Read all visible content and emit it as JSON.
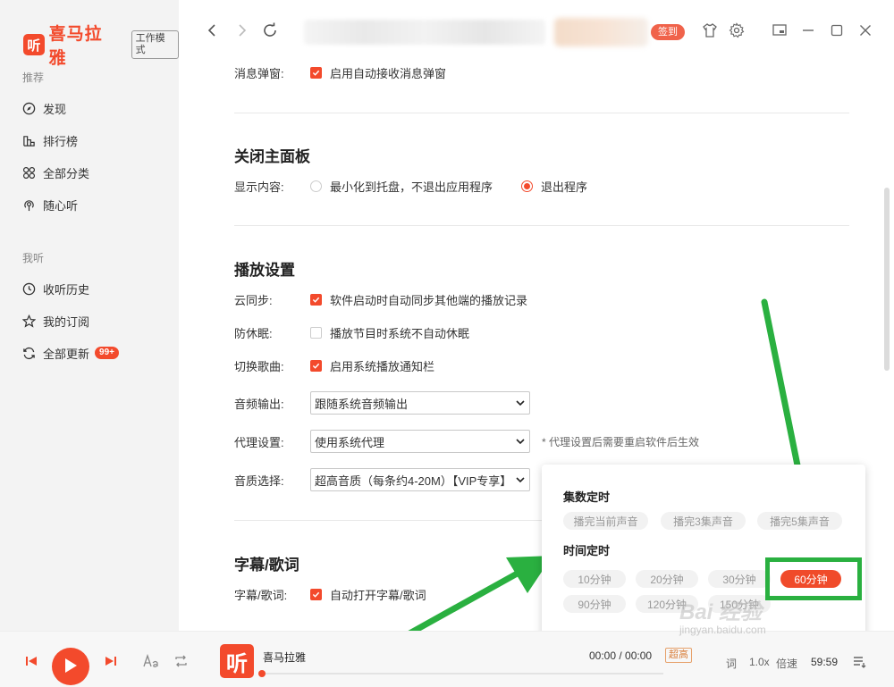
{
  "app": {
    "logo_glyph": "听",
    "name": "喜马拉雅",
    "work_mode": "工作模式",
    "brand_color": "#f34a2c"
  },
  "sidebar": {
    "section_recommend": "推荐",
    "recommend_items": [
      {
        "label": "发现",
        "icon": "compass-icon"
      },
      {
        "label": "排行榜",
        "icon": "ranking-icon"
      },
      {
        "label": "全部分类",
        "icon": "category-grid-icon"
      },
      {
        "label": "随心听",
        "icon": "radio-icon"
      }
    ],
    "section_mine": "我听",
    "mine_items": [
      {
        "label": "收听历史",
        "icon": "clock-icon"
      },
      {
        "label": "我的订阅",
        "icon": "star-icon"
      },
      {
        "label": "全部更新",
        "icon": "refresh-icon",
        "badge": "99+"
      }
    ]
  },
  "topbar": {
    "sign_label": "签到"
  },
  "settings": {
    "popup_label": "消息弹窗:",
    "popup_option": "启用自动接收消息弹窗",
    "close_panel_title": "关闭主面板",
    "display_label": "显示内容:",
    "display_options": [
      "最小化到托盘，不退出应用程序",
      "退出程序"
    ],
    "display_selected": "退出程序",
    "playback_title": "播放设置",
    "cloud_sync_label": "云同步:",
    "cloud_sync_option": "软件启动时自动同步其他端的播放记录",
    "no_sleep_label": "防休眠:",
    "no_sleep_option": "播放节目时系统不自动休眠",
    "switch_song_label": "切换歌曲:",
    "switch_song_option": "启用系统播放通知栏",
    "audio_out_label": "音频输出:",
    "audio_out_value": "跟随系统音频输出",
    "proxy_label": "代理设置:",
    "proxy_value": "使用系统代理",
    "proxy_note": "* 代理设置后需要重启软件后生效",
    "quality_label": "音质选择:",
    "quality_value": "超高音质（每条约4-20M）【VIP专享】",
    "subtitle_title": "字幕/歌词",
    "subtitle_label": "字幕/歌词:",
    "subtitle_option": "自动打开字幕/歌词"
  },
  "timer_popup": {
    "episode_title": "集数定时",
    "episode_options": [
      "播完当前声音",
      "播完3集声音",
      "播完5集声音"
    ],
    "time_title": "时间定时",
    "time_options": [
      "10分钟",
      "20分钟",
      "30分钟",
      "60分钟",
      "90分钟",
      "120分钟",
      "150分钟"
    ],
    "time_selected": "60分钟"
  },
  "player": {
    "cover_glyph": "听",
    "track_title": "喜马拉雅",
    "time": "00:00 / 00:00",
    "quality": "超高",
    "lyrics_label": "词",
    "speed_label": "1.0x",
    "rate_label": "倍速",
    "countdown": "59:59",
    "progress": 0
  },
  "watermark": {
    "text": "Bai 经验",
    "sub": "jingyan.baidu.com"
  }
}
